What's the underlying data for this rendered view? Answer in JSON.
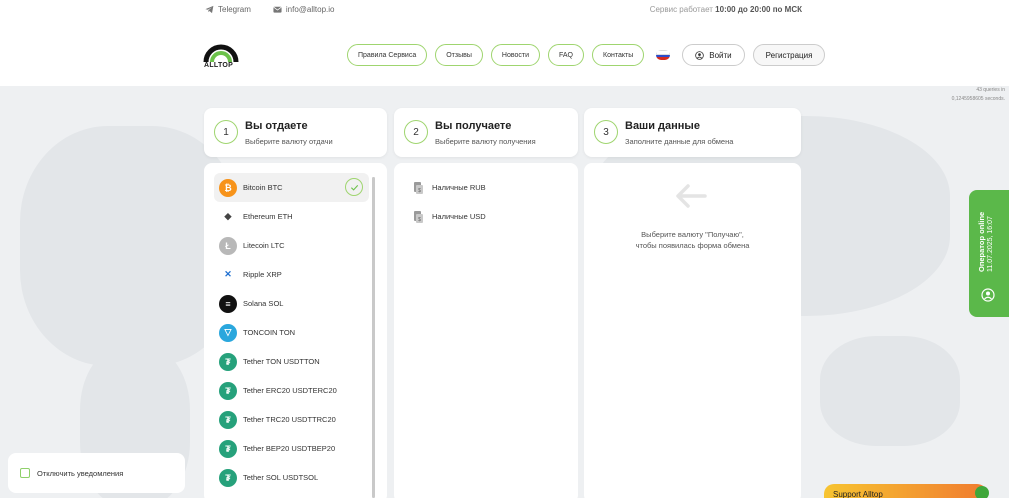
{
  "header": {
    "telegram_label": "Telegram",
    "email_label": "info@alltop.io",
    "schedule_prefix": "Сервис работает",
    "schedule_hours": "10:00 до 20:00 по МСК",
    "logo_text": "ALLTOP",
    "nav": [
      "Правила Сервиса",
      "Отзывы",
      "Новости",
      "FAQ",
      "Контакты"
    ],
    "login_label": "Войти",
    "register_label": "Регистрация"
  },
  "queries": {
    "line1": "43 queries in",
    "line2": "0,1245958605 seconds."
  },
  "steps": [
    {
      "num": "1",
      "title": "Вы отдаете",
      "sub": "Выберите валюту отдачи"
    },
    {
      "num": "2",
      "title": "Вы получаете",
      "sub": "Выберите валюту получения"
    },
    {
      "num": "3",
      "title": "Ваши данные",
      "sub": "Заполните данные для обмена"
    }
  ],
  "give": [
    {
      "label": "Bitcoin BTC",
      "icon": "bitcoin-icon",
      "color": "#f7931a",
      "glyph": "₿",
      "active": true
    },
    {
      "label": "Ethereum ETH",
      "icon": "ethereum-icon",
      "color": "#ffffff",
      "glyph": "◆"
    },
    {
      "label": "Litecoin LTC",
      "icon": "litecoin-icon",
      "color": "#b8b8b8",
      "glyph": "Ł"
    },
    {
      "label": "Ripple XRP",
      "icon": "ripple-icon",
      "color": "#ffffff",
      "glyph": "✕"
    },
    {
      "label": "Solana SOL",
      "icon": "solana-icon",
      "color": "#111111",
      "glyph": "≡"
    },
    {
      "label": "TONCOIN TON",
      "icon": "toncoin-icon",
      "color": "#2aa7dd",
      "glyph": "▽"
    },
    {
      "label": "Tether TON USDTTON",
      "icon": "tether-icon",
      "color": "#26a17b",
      "glyph": "₮"
    },
    {
      "label": "Tether ERC20 USDTERC20",
      "icon": "tether-icon",
      "color": "#26a17b",
      "glyph": "₮"
    },
    {
      "label": "Tether TRC20 USDTTRC20",
      "icon": "tether-icon",
      "color": "#26a17b",
      "glyph": "₮"
    },
    {
      "label": "Tether BEP20 USDTBEP20",
      "icon": "tether-icon",
      "color": "#26a17b",
      "glyph": "₮"
    },
    {
      "label": "Tether SOL USDTSOL",
      "icon": "tether-icon",
      "color": "#26a17b",
      "glyph": "₮"
    }
  ],
  "get": [
    "Наличные RUB",
    "Наличные USD"
  ],
  "details_hint": {
    "line1": "Выберите валюту \"Получаю\",",
    "line2": "чтобы появилась форма обмена"
  },
  "operator": {
    "status": "Оператор online",
    "time": "11.07.2025, 16:07"
  },
  "notify_label": "Отключить уведомления",
  "support_label": "Support Alltop",
  "colors": {
    "accent": "#9fd56f",
    "operator": "#5bb84a"
  }
}
